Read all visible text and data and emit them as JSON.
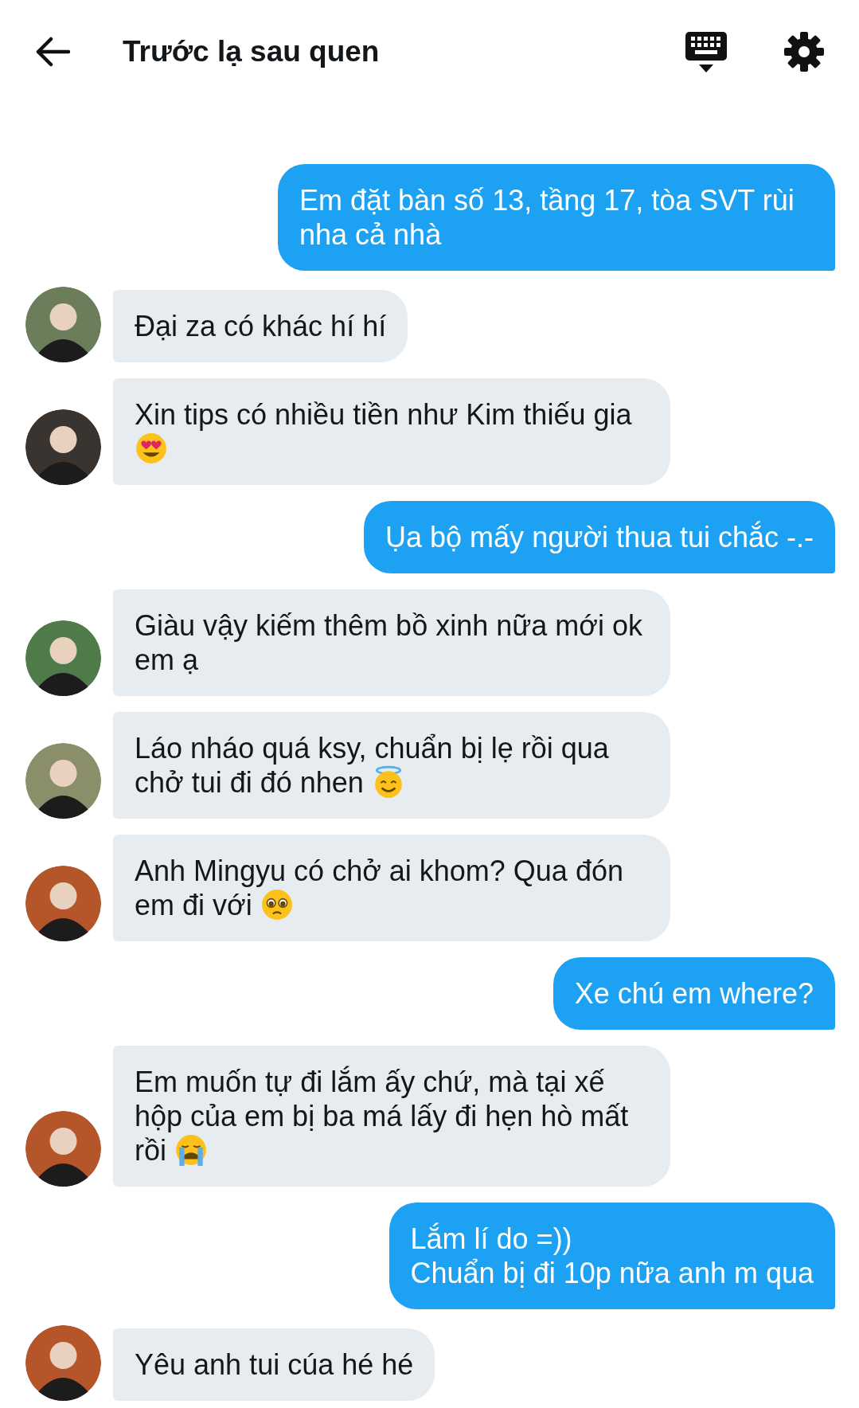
{
  "header": {
    "title": "Trước lạ sau quen"
  },
  "messages": [
    {
      "kind": "outgoing",
      "text": "Em đặt bàn số 13, tầng 17, tòa SVT rùi nha cả nhà"
    },
    {
      "kind": "incoming",
      "text": "Đại za có khác hí hí",
      "color": "#6b7d5a"
    },
    {
      "kind": "incoming",
      "text": "Xin tips có nhiều tiền như Kim thiếu gia",
      "emoji": {
        "kind": "heart-eyes"
      },
      "color": "#3a3430"
    },
    {
      "kind": "outgoing",
      "text": "Ụa bộ mấy người thua tui chắc -.-"
    },
    {
      "kind": "incoming",
      "text": "Giàu vậy kiếm thêm bồ xinh nữa mới ok em ạ",
      "color": "#4f7a4a"
    },
    {
      "kind": "incoming",
      "text": "Láo nháo quá ksy, chuẩn bị lẹ rồi qua chở tui đi đó nhen",
      "emoji": {
        "kind": "halo"
      },
      "color": "#8a8f6a"
    },
    {
      "kind": "incoming",
      "text": "Anh Mingyu có chở ai khom? Qua đón em đi với",
      "emoji": {
        "kind": "pleading"
      },
      "color": "#b5552a"
    },
    {
      "kind": "outgoing",
      "text": "Xe chú em where?"
    },
    {
      "kind": "incoming",
      "text": "Em muốn tự đi lắm ấy chứ, mà tại xế hộp của em bị ba má lấy đi hẹn hò mất rồi",
      "emoji": {
        "kind": "crying"
      },
      "color": "#b5552a"
    },
    {
      "kind": "outgoing",
      "text": "Lắm lí do =))\nChuẩn bị đi 10p nữa anh m qua"
    },
    {
      "kind": "incoming",
      "text": "Yêu anh tui cúa hé hé",
      "color": "#b5552a"
    }
  ]
}
